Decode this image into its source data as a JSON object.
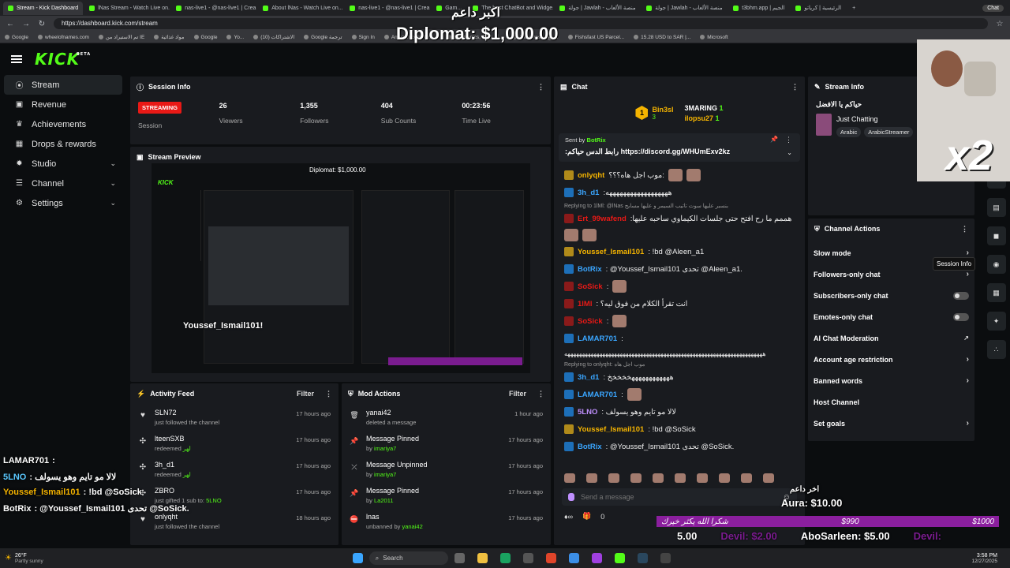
{
  "browser": {
    "tabs": [
      {
        "label": "Stream - Kick Dashboard",
        "active": true
      },
      {
        "label": "lNas Stream - Watch Live on..."
      },
      {
        "label": "nas-live1 - @nas-live1 | Crea..."
      },
      {
        "label": "About lNas - Watch Live on..."
      },
      {
        "label": "nas-live1 - @nas-live1 | Crea..."
      },
      {
        "label": "Gam..."
      },
      {
        "label": "The best ChatBot and Widge..."
      },
      {
        "label": "جولة | Jawlah - منصة الألعاب"
      },
      {
        "label": "جولة | Jawlah - منصة الألعاب"
      },
      {
        "label": "t3bhm.app | الجيم"
      },
      {
        "label": "الرئيسية | كرياتو"
      }
    ],
    "url": "https://dashboard.kick.com/stream",
    "new_tab_label": "+",
    "profile_label": "Chat",
    "bookmarks": [
      "Google",
      "wheelofnames.com",
      "تم الاستيراد من IE",
      "مواد غذائية",
      "Google",
      "Yo...",
      "(10) الاشتراكات",
      "Google ترجمة",
      "Sign In",
      "Amazon.com: Onli...",
      "Electronics, Cars, F...",
      "AliExpress - موقع",
      "Fishsfast US Parcel...",
      "15.28 USD to SAR |...",
      "Microsoft"
    ]
  },
  "header": {
    "logo": "KICK",
    "logo_badge": "BETA"
  },
  "sidebar": {
    "items": [
      {
        "label": "Stream",
        "icon": "stream-icon"
      },
      {
        "label": "Revenue",
        "icon": "revenue-icon"
      },
      {
        "label": "Achievements",
        "icon": "trophy-icon"
      },
      {
        "label": "Drops & rewards",
        "icon": "gift-icon"
      },
      {
        "label": "Studio",
        "icon": "studio-icon",
        "chevron": true
      },
      {
        "label": "Channel",
        "icon": "channel-icon",
        "chevron": true
      },
      {
        "label": "Settings",
        "icon": "gear-icon",
        "chevron": true
      }
    ]
  },
  "session_info": {
    "title": "Session Info",
    "badge": "STREAMING",
    "session_label": "Session",
    "stats": [
      {
        "value": "26",
        "label": "Viewers"
      },
      {
        "value": "1,355",
        "label": "Followers"
      },
      {
        "value": "404",
        "label": "Sub Counts"
      },
      {
        "value": "00:23:56",
        "label": "Time Live"
      }
    ]
  },
  "stream_preview": {
    "title": "Stream Preview",
    "overlay_name": "Youssef_Ismail101!",
    "overlay_diplomat": "Diplomat: $1,000.00"
  },
  "activity_feed": {
    "title": "Activity Feed",
    "filter": "Filter",
    "items": [
      {
        "user": "SLN72",
        "action": "just followed the channel",
        "time": "17 hours ago",
        "icon": "heart-icon"
      },
      {
        "user": "lteenSXB",
        "action": "redeemed",
        "extra": "لهر",
        "time": "17 hours ago",
        "icon": "reward-icon"
      },
      {
        "user": "3h_d1",
        "action": "redeemed",
        "extra": "لهر",
        "time": "17 hours ago",
        "icon": "reward-icon"
      },
      {
        "user": "ZBRO",
        "action": "just gifted 1 sub to:",
        "extra": "5LNO",
        "time": "17 hours ago",
        "icon": "gift-icon"
      },
      {
        "user": "onlyqht",
        "action": "just followed the channel",
        "time": "18 hours ago",
        "icon": "heart-icon"
      }
    ]
  },
  "mod_actions": {
    "title": "Mod Actions",
    "filter": "Filter",
    "items": [
      {
        "title": "yanai42",
        "sub": "deleted a message",
        "time": "1 hour ago",
        "icon": "trash-icon"
      },
      {
        "title": "Message Pinned",
        "sub": "by ",
        "by": "imariya7",
        "time": "17 hours ago",
        "icon": "pin-icon"
      },
      {
        "title": "Message Unpinned",
        "sub": "by ",
        "by": "imariya7",
        "time": "17 hours ago",
        "icon": "unpin-icon"
      },
      {
        "title": "Message Pinned",
        "sub": "by ",
        "by": "La2011",
        "time": "17 hours ago",
        "icon": "pin-icon"
      },
      {
        "title": "lnas",
        "sub": "unbanned by ",
        "by": "yanai42",
        "time": "17 hours ago",
        "icon": "ban-icon"
      }
    ]
  },
  "chat": {
    "title": "Chat",
    "leaderboard": [
      {
        "rank": "1",
        "name": "Bin3sl",
        "count": "3"
      },
      {
        "name": "3MARING",
        "count": "1"
      },
      {
        "name": "ilopsu27",
        "count": "1"
      }
    ],
    "pinned": {
      "sent_by_label": "Sent by",
      "sender": "BotRix",
      "text": ":رابط الدس حياكم https://discord.gg/WHUmExv2kz"
    },
    "messages": [
      {
        "type": "msg",
        "user": "onlyqht",
        "cls": "u1",
        "text": "موب اجل هاه؟؟؟:",
        "emotes": 2
      },
      {
        "type": "msg",
        "user": "3h_d1",
        "cls": "u2",
        "text": ":ههههههههههههههههههه"
      },
      {
        "type": "reply",
        "text": "Replying to 1lMl: @lNas بنسبر عليها سوت تاتيب السيمر و عليها مسايح"
      },
      {
        "type": "msg",
        "user": "Ert_99wafend",
        "cls": "u3",
        "text": ":هممم ما رح افتح حتى جلسات الكيماوي ساحبه عليها"
      },
      {
        "type": "emote",
        "count": 2
      },
      {
        "type": "msg",
        "user": "Youssef_Ismail101",
        "cls": "u1",
        "text": ": !bd @Aleen_a1"
      },
      {
        "type": "msg",
        "user": "BotRix",
        "cls": "u2",
        "text": ": @Youssef_Ismail101 تحدى @Aleen_a1."
      },
      {
        "type": "msg",
        "user": "SoSick",
        "cls": "u3",
        "text": ":",
        "emotes": 1
      },
      {
        "type": "msg",
        "user": "1lMl",
        "cls": "u3",
        "text": ": انت تقرأ الكلام من فوق ليه؟"
      },
      {
        "type": "msg",
        "user": "SoSick",
        "cls": "u3",
        "text": ":",
        "emotes": 1
      },
      {
        "type": "msg",
        "user": "LAMAR701",
        "cls": "u2",
        "text": ":"
      },
      {
        "type": "text",
        "text": "ههههههههههههههههههههههههههههههههههههههههههههههههههههههههههههههههههههه"
      },
      {
        "type": "reply",
        "text": "Replying to onlyqht: موب اجل هاه"
      },
      {
        "type": "msg",
        "user": "3h_d1",
        "cls": "u2",
        "text": ": ههههههههههههخخخخخ"
      },
      {
        "type": "msg",
        "user": "LAMAR701",
        "cls": "u2",
        "text": ":",
        "emotes": 1
      },
      {
        "type": "msg",
        "user": "5LNO",
        "cls": "u5",
        "text": ": لالا مو تايم وهو يسولف"
      },
      {
        "type": "msg",
        "user": "Youssef_Ismail101",
        "cls": "u1",
        "text": ": !bd @SoSick"
      },
      {
        "type": "msg",
        "user": "BotRix",
        "cls": "u2",
        "text": ": @Youssef_Ismail101 تحدى @SoSick."
      }
    ],
    "input_placeholder": "Send a message",
    "footer_count": "0"
  },
  "stream_info": {
    "title": "Stream Info",
    "stream_title": "حياكم يا الافضل",
    "category": "Just Chatting",
    "tags": [
      "Arabic",
      "ArabicStreamer"
    ]
  },
  "channel_actions": {
    "title": "Channel Actions",
    "items": [
      {
        "label": "Slow mode",
        "control": "chevron"
      },
      {
        "label": "Followers-only chat",
        "control": "chevron"
      },
      {
        "label": "Subscribers-only chat",
        "control": "toggle"
      },
      {
        "label": "Emotes-only chat",
        "control": "toggle"
      },
      {
        "label": "AI Chat Moderation",
        "control": "external"
      },
      {
        "label": "Account age restriction",
        "control": "chevron"
      },
      {
        "label": "Banned words",
        "control": "chevron"
      },
      {
        "label": "Host Channel",
        "control": "none"
      },
      {
        "label": "Set goals",
        "control": "chevron"
      }
    ],
    "tooltip": "Session Info"
  },
  "overlays": {
    "top_arabic": "اكبر داعم",
    "diplomat": "Diplomat: $1,000.00",
    "multiplier": "x2",
    "aura_arabic": "اخر داعم",
    "aura": "Aura: $10.00",
    "goal_left": "$990",
    "goal_right": "$1000",
    "goal_text": "شكرا الله يكثر خيرك",
    "ticker": [
      "5.00",
      "Devil: $2.00",
      "AboSarleen: $5.00",
      "Devil:"
    ],
    "chat_lines": [
      {
        "user": "LAMAR701",
        "text": ":"
      },
      {
        "user": "5LNO",
        "text": ": لالا مو تايم وهو يسولف"
      },
      {
        "user": "Youssef_Ismail101",
        "text": ": !bd @SoSick"
      },
      {
        "user": "BotRix",
        "text": ": @Youssef_Ismail101 تحدى @SoSick."
      }
    ]
  },
  "taskbar": {
    "weather_temp": "26°F",
    "weather_desc": "Partly sunny",
    "search": "Search",
    "time": "3:58 PM",
    "date": "12/27/2025"
  },
  "colors": {
    "accent": "#53fc18",
    "live": "#e91916",
    "panel": "#191b1f",
    "bg": "#0b0d0f"
  }
}
